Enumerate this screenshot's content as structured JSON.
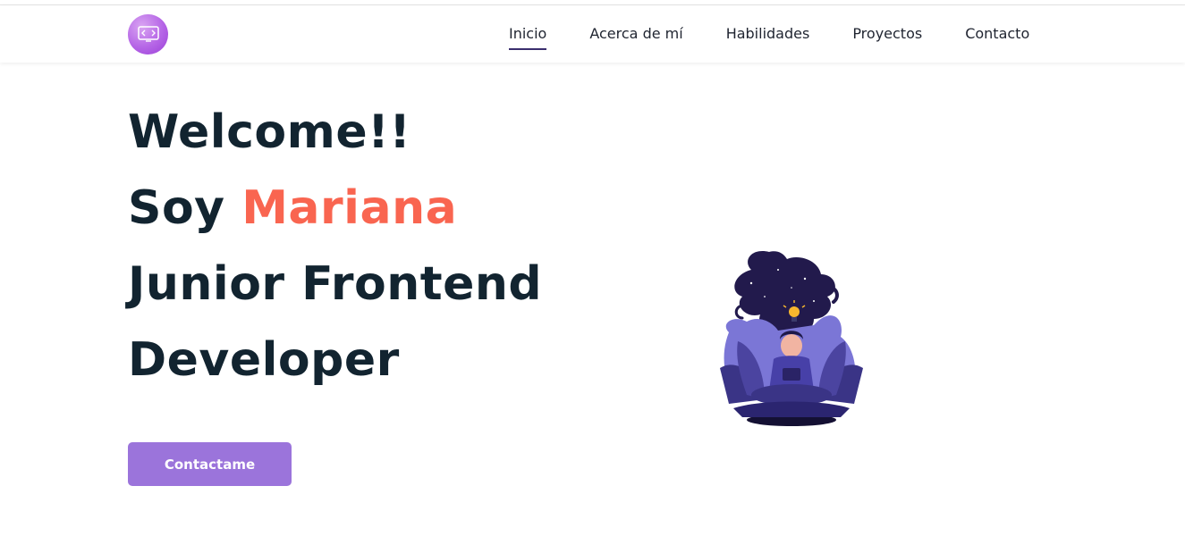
{
  "nav": {
    "items": [
      {
        "label": "Inicio",
        "active": true
      },
      {
        "label": "Acerca de mí",
        "active": false
      },
      {
        "label": "Habilidades",
        "active": false
      },
      {
        "label": "Proyectos",
        "active": false
      },
      {
        "label": "Contacto",
        "active": false
      }
    ],
    "logo_icon": "code-icon"
  },
  "hero": {
    "line1": "Welcome!!",
    "line2_prefix": "Soy ",
    "line2_name": "Mariana",
    "line3": "Junior Frontend",
    "line4": "Developer",
    "cta_label": "Contactame"
  },
  "illustration_icon": "meditating-reader-illustration",
  "colors": {
    "heading": "#122430",
    "accent": "#f96550",
    "button": "#9b74db",
    "nav_underline": "#3a2e6e"
  }
}
